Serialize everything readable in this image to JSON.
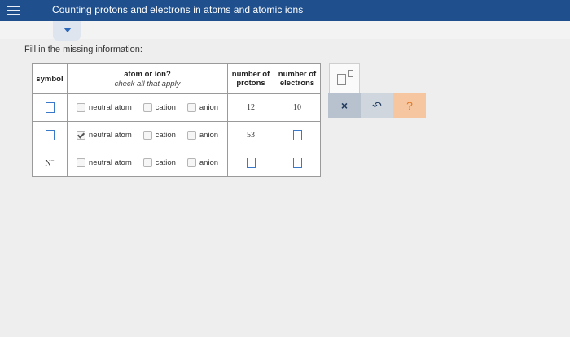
{
  "app": {
    "title": "Counting protons and electrons in atoms and atomic ions"
  },
  "question": {
    "prompt": "Fill in the missing information:"
  },
  "table": {
    "headers": {
      "symbol": "symbol",
      "atom_or_ion": "atom or ion?",
      "atom_or_ion_sub": "check all that apply",
      "protons": "number of protons",
      "electrons": "number of electrons"
    },
    "options": {
      "neutral": "neutral atom",
      "cation": "cation",
      "anion": "anion"
    },
    "rows": [
      {
        "symbol": "",
        "neutral_checked": false,
        "cation_checked": false,
        "anion_checked": false,
        "protons": "12",
        "electrons": "10"
      },
      {
        "symbol": "",
        "neutral_checked": true,
        "cation_checked": false,
        "anion_checked": false,
        "protons": "53",
        "electrons": ""
      },
      {
        "symbol": "N",
        "symbol_charge": "−",
        "neutral_checked": false,
        "cation_checked": false,
        "anion_checked": false,
        "protons": "",
        "electrons": ""
      }
    ]
  },
  "actions": {
    "clear": "×",
    "undo": "↶",
    "help": "?"
  },
  "colors": {
    "topbar": "#1f4f8c",
    "input_border": "#3a79c9",
    "help": "#f5c69f"
  }
}
